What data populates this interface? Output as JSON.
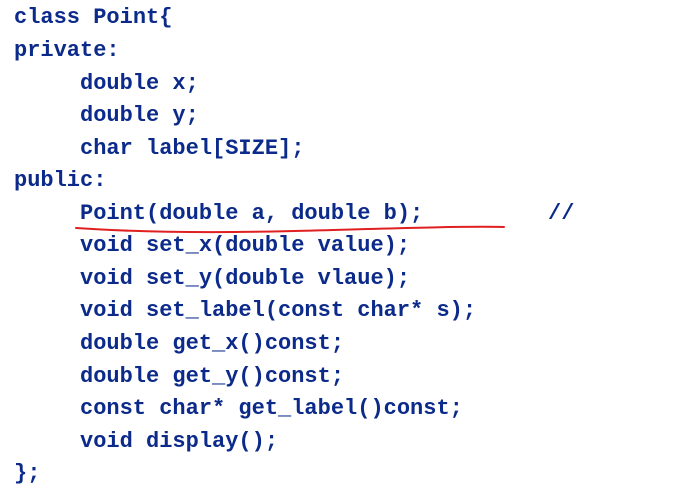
{
  "code": {
    "lines": [
      "class Point{",
      "private:",
      "double x;",
      "double y;",
      "char label[SIZE];",
      "public:",
      "Point(double a, double b);",
      "void set_x(double value);",
      "void set_y(double vlaue);",
      "void set_label(const char* s);",
      "double get_x()const;",
      "double get_y()const;",
      "const char* get_label()const;",
      "void display();",
      "};"
    ],
    "comment": "//"
  },
  "colors": {
    "code_text": "#0b2a8a",
    "annotation": "#e02020",
    "background": "#ffffff"
  }
}
